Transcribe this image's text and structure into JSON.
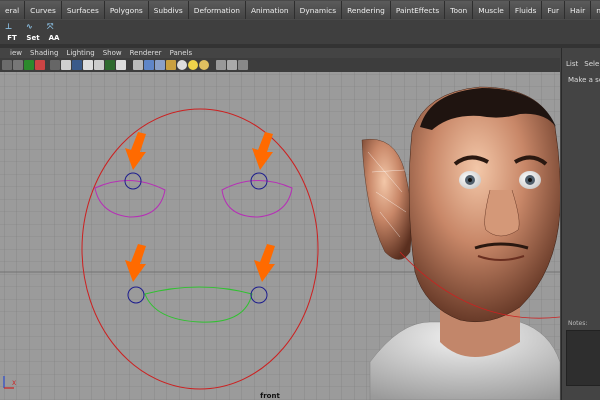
{
  "menu_tabs": [
    "eral",
    "Curves",
    "Surfaces",
    "Polygons",
    "Subdivs",
    "Deformation",
    "Animation",
    "Dynamics",
    "Rendering",
    "PaintEffects",
    "Toon",
    "Muscle",
    "Fluids",
    "Fur",
    "Hair",
    "nCloth"
  ],
  "shelf": {
    "buttons": [
      {
        "label": "FT",
        "icon": "pivot-icon"
      },
      {
        "label": "Set",
        "icon": "curve-tool-icon"
      },
      {
        "label": "AA",
        "icon": "move-axis-icon"
      }
    ]
  },
  "panel_menu": [
    "iew",
    "Shading",
    "Lighting",
    "Show",
    "Renderer",
    "Panels"
  ],
  "viewport": {
    "camera_label": "front",
    "marker_arrow_color": "#ff6a00",
    "face_outline_color": "#cc2020",
    "eye_curve_color": "#b62fb6",
    "mouth_curve_color": "#2fc22f",
    "locator_color": "#1d1d8e"
  },
  "right_panel": {
    "tabs": [
      "List",
      "Sele"
    ],
    "hint": "Make a sele",
    "notes_label": "Notes:"
  }
}
